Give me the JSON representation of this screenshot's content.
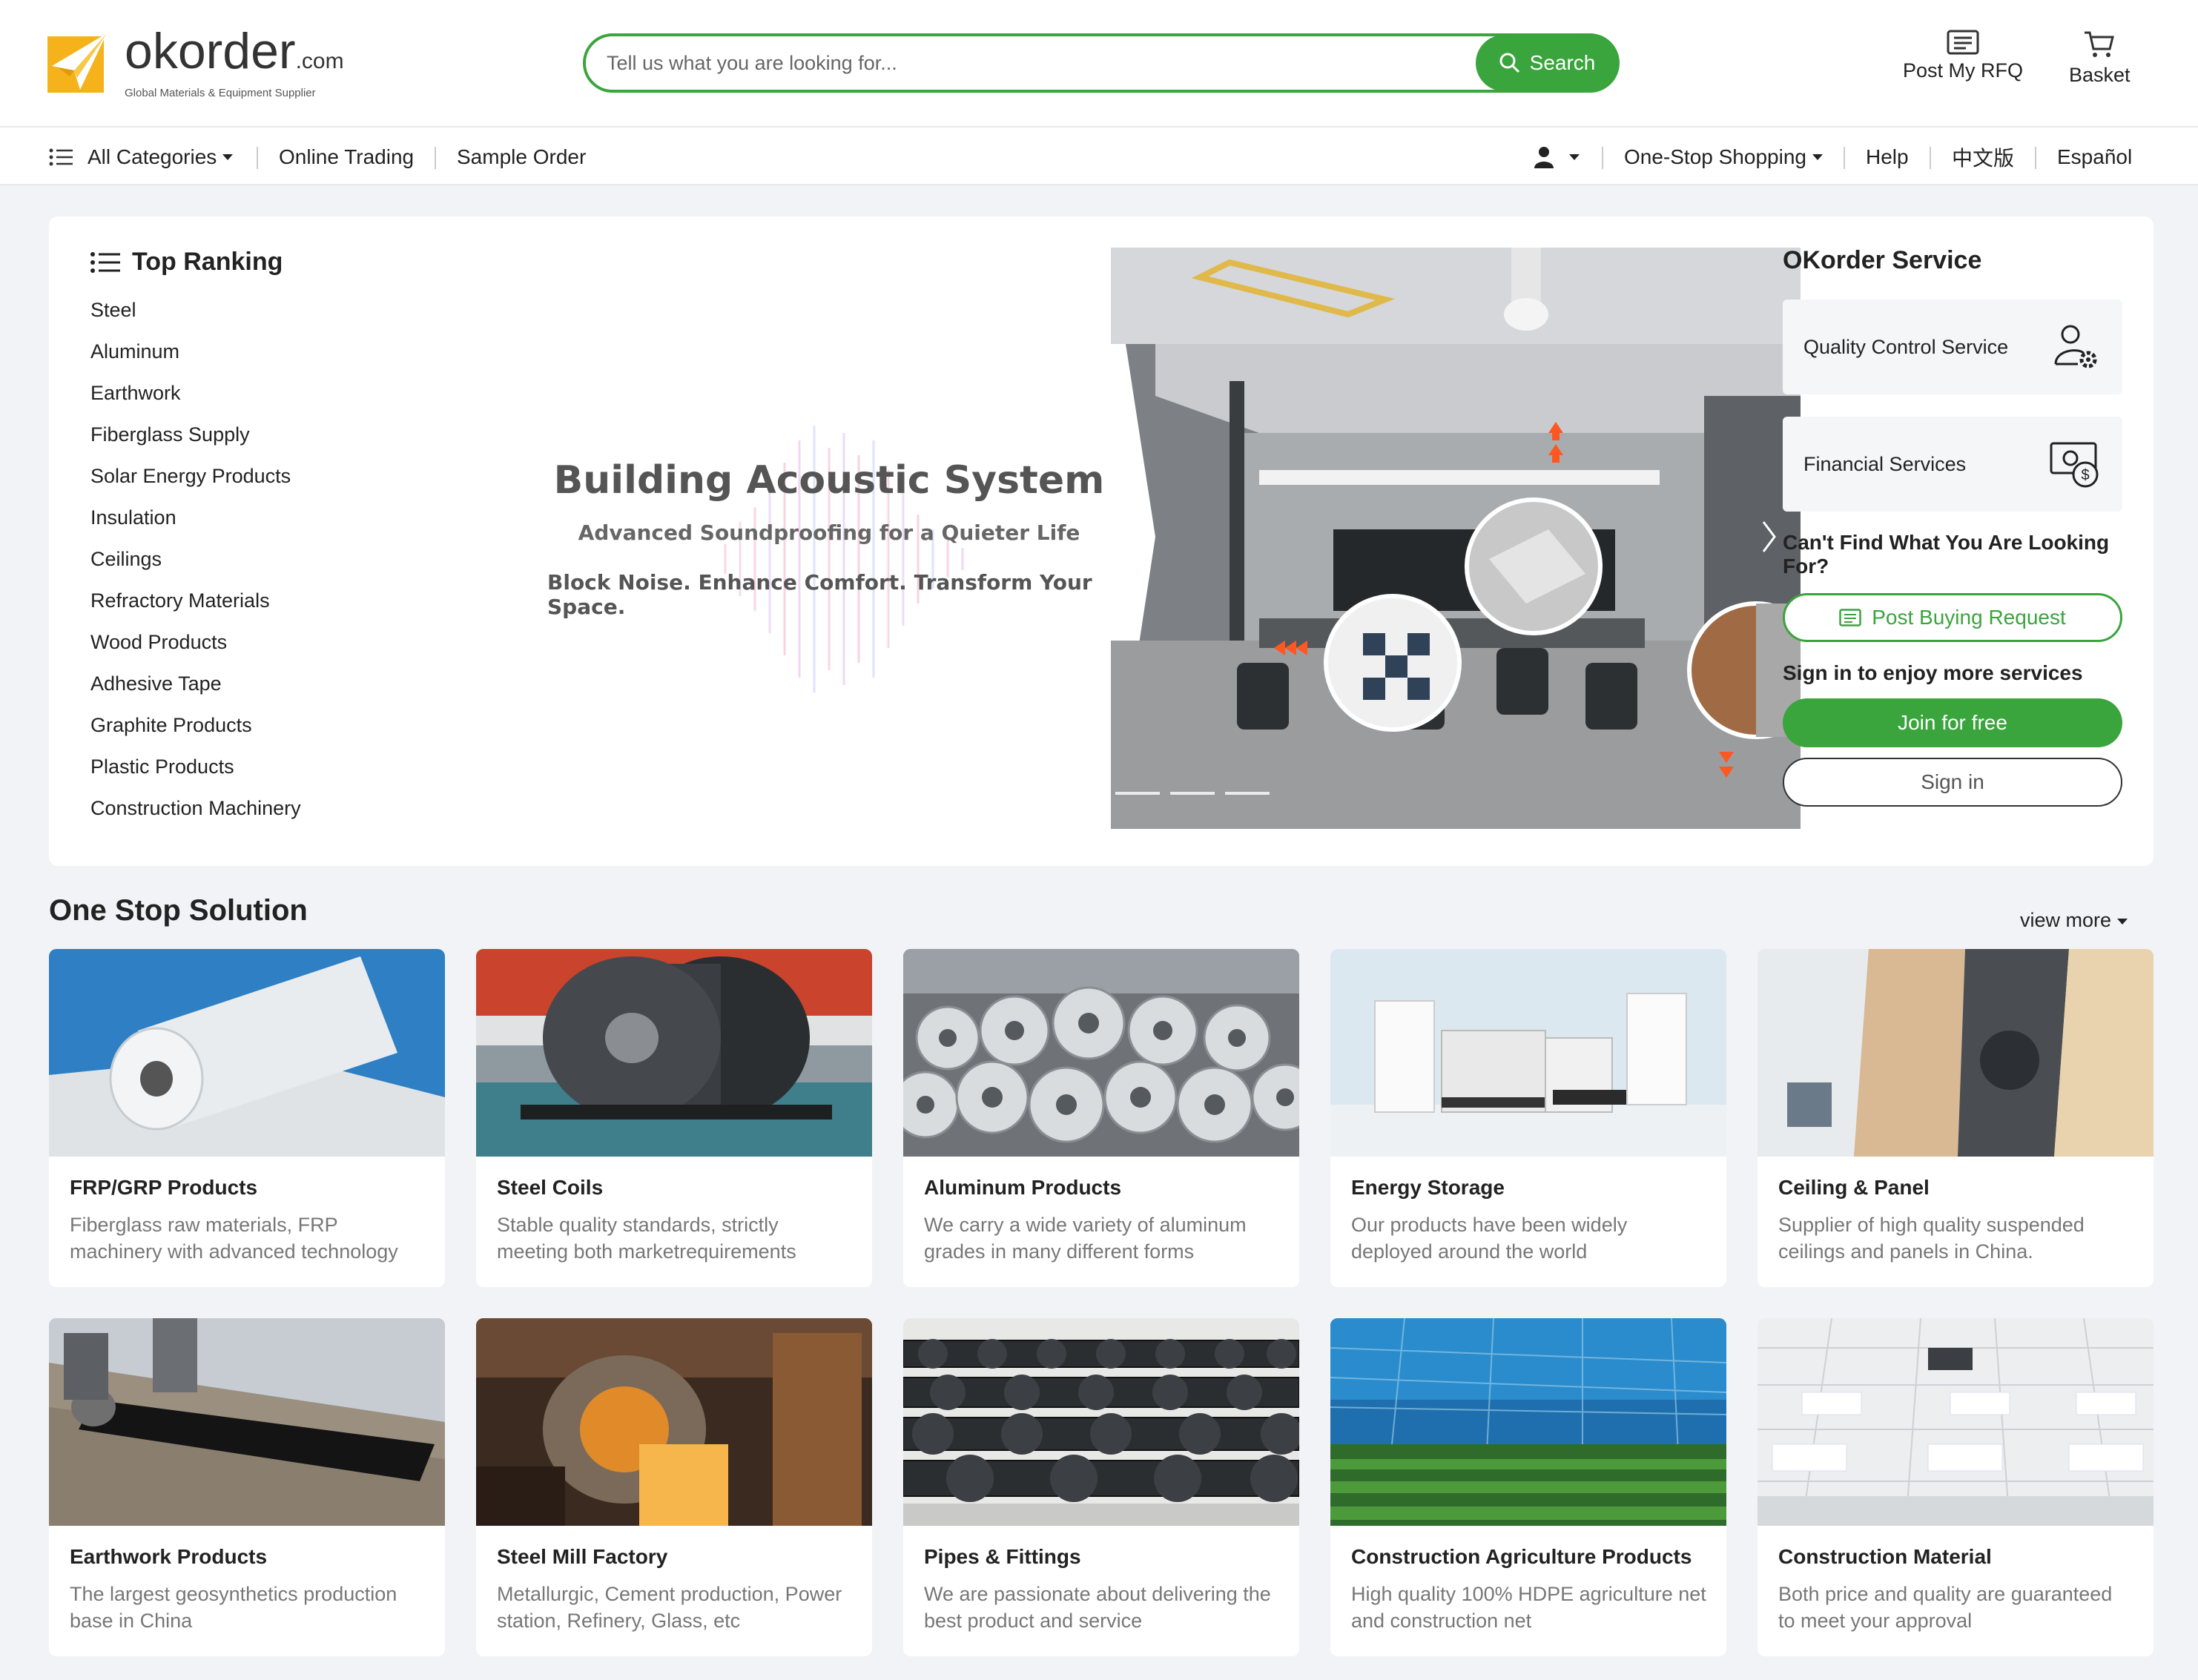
{
  "header": {
    "logo_main": "okorder",
    "logo_suffix": ".com",
    "logo_tagline": "Global Materials & Equipment Supplier",
    "search_placeholder": "Tell us what you are looking for...",
    "search_button": "Search",
    "rfq_label": "Post My RFQ",
    "basket_label": "Basket"
  },
  "nav": {
    "all_categories": "All Categories",
    "online_trading": "Online Trading",
    "sample_order": "Sample Order",
    "one_stop_shopping": "One-Stop Shopping",
    "help": "Help",
    "chinese": "中文版",
    "spanish": "Español"
  },
  "ranking": {
    "title": "Top Ranking",
    "items": [
      "Steel",
      "Aluminum",
      "Earthwork",
      "Fiberglass Supply",
      "Solar Energy Products",
      "Insulation",
      "Ceilings",
      "Refractory Materials",
      "Wood Products",
      "Adhesive Tape",
      "Graphite Products",
      "Plastic Products",
      "Construction Machinery"
    ]
  },
  "banner": {
    "title": "Building Acoustic System",
    "subtitle": "Advanced Soundproofing for a Quieter Life",
    "tagline": "Block Noise. Enhance Comfort. Transform Your Space."
  },
  "service": {
    "title": "OKorder Service",
    "quality_control": "Quality Control Service",
    "financial": "Financial Services",
    "cant_find": "Can't Find What You Are Looking For?",
    "post_buying": "Post Buying Request",
    "sign_in_msg": "Sign in to enjoy more services",
    "join": "Join for free",
    "sign_in": "Sign in"
  },
  "one_stop": {
    "title": "One Stop Solution",
    "view_more": "view more",
    "cards": [
      {
        "title": "FRP/GRP Products",
        "desc": "Fiberglass raw materials, FRP machinery with advanced technology"
      },
      {
        "title": "Steel Coils",
        "desc": "Stable quality standards, strictly meeting both marketrequirements"
      },
      {
        "title": "Aluminum Products",
        "desc": "We carry a wide variety of aluminum grades in many different forms"
      },
      {
        "title": "Energy Storage",
        "desc": "Our products have been widely deployed around the world"
      },
      {
        "title": "Ceiling & Panel",
        "desc": "Supplier of high quality suspended ceilings and panels in China."
      },
      {
        "title": "Earthwork Products",
        "desc": "The largest geosynthetics production base in China"
      },
      {
        "title": "Steel Mill Factory",
        "desc": "Metallurgic, Cement production, Power station, Refinery, Glass, etc"
      },
      {
        "title": "Pipes & Fittings",
        "desc": "We are passionate about delivering the best product and service"
      },
      {
        "title": "Construction Agriculture Products",
        "desc": "High quality 100% HDPE agriculture net and construction net"
      },
      {
        "title": "Construction Material",
        "desc": "Both price and quality are guaranteed to meet your approval"
      }
    ]
  },
  "colors": {
    "brand_green": "#3aa43d",
    "logo_yellow": "#f5b21b",
    "page_bg": "#f1f3f7"
  }
}
